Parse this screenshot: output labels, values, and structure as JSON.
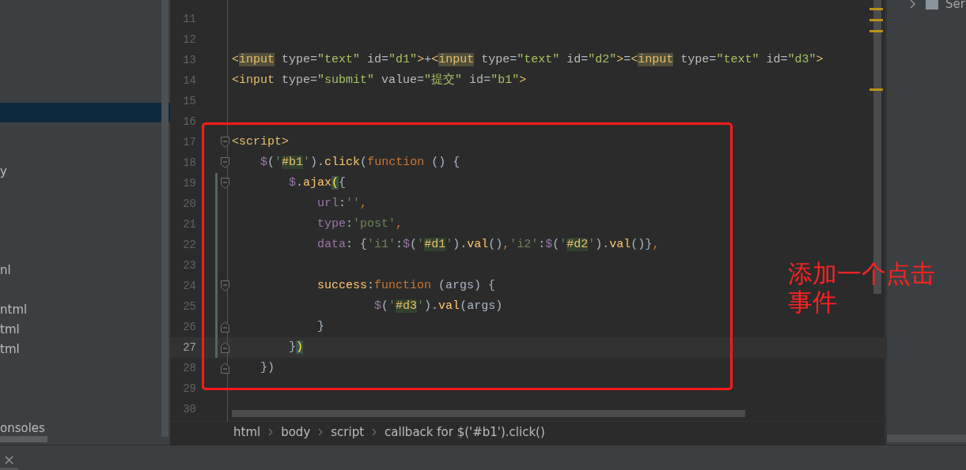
{
  "project_panel": {
    "items": [
      {
        "selected": true
      },
      {
        "label": "y",
        "selected": false
      },
      {
        "label": "nl",
        "selected": false
      },
      {
        "label": "ntml",
        "selected": false
      },
      {
        "label": "tml",
        "selected": false
      },
      {
        "label": "tml",
        "selected": false
      },
      {
        "label": "onsoles",
        "selected": false
      }
    ]
  },
  "editor": {
    "lines": [
      {
        "number": "11"
      },
      {
        "number": "12"
      },
      {
        "number": "13",
        "tokens": [
          {
            "kind": "tag",
            "text": "<"
          },
          {
            "kind": "tag_match",
            "text": "input"
          },
          {
            "kind": "attr",
            "text": " type"
          },
          {
            "kind": "punct",
            "text": "="
          },
          {
            "kind": "str",
            "text": "\"text\""
          },
          {
            "kind": "attr",
            "text": " id"
          },
          {
            "kind": "punct",
            "text": "="
          },
          {
            "kind": "str",
            "text": "\"d1\""
          },
          {
            "kind": "tag",
            "text": ">"
          },
          {
            "kind": "punct",
            "text": "+"
          },
          {
            "kind": "tag",
            "text": "<"
          },
          {
            "kind": "tag_match",
            "text": "input"
          },
          {
            "kind": "attr",
            "text": " type"
          },
          {
            "kind": "punct",
            "text": "="
          },
          {
            "kind": "str",
            "text": "\"text\""
          },
          {
            "kind": "attr",
            "text": " id"
          },
          {
            "kind": "punct",
            "text": "="
          },
          {
            "kind": "str",
            "text": "\"d2\""
          },
          {
            "kind": "tag",
            "text": ">"
          },
          {
            "kind": "punct",
            "text": "="
          },
          {
            "kind": "tag",
            "text": "<"
          },
          {
            "kind": "tag_match",
            "text": "input"
          },
          {
            "kind": "attr",
            "text": " type"
          },
          {
            "kind": "punct",
            "text": "="
          },
          {
            "kind": "str",
            "text": "\"text\""
          },
          {
            "kind": "attr",
            "text": " id"
          },
          {
            "kind": "punct",
            "text": "="
          },
          {
            "kind": "str",
            "text": "\"d3\""
          },
          {
            "kind": "tag",
            "text": ">"
          }
        ]
      },
      {
        "number": "14",
        "tokens": [
          {
            "kind": "tag",
            "text": "<input"
          },
          {
            "kind": "attr",
            "text": " type"
          },
          {
            "kind": "punct",
            "text": "="
          },
          {
            "kind": "str",
            "text": "\"submit\""
          },
          {
            "kind": "attr",
            "text": " value"
          },
          {
            "kind": "punct",
            "text": "="
          },
          {
            "kind": "str",
            "text": "\"提交\""
          },
          {
            "kind": "attr",
            "text": " id"
          },
          {
            "kind": "punct",
            "text": "="
          },
          {
            "kind": "str",
            "text": "\"b1\""
          },
          {
            "kind": "tag",
            "text": ">"
          }
        ]
      },
      {
        "number": "15"
      },
      {
        "number": "16"
      },
      {
        "number": "17",
        "fold_start": true,
        "tokens": [
          {
            "kind": "tag",
            "text": "<script>"
          }
        ]
      },
      {
        "number": "18",
        "fold_start": true,
        "tokens": [
          {
            "kind": "var",
            "text": "    $"
          },
          {
            "kind": "punct",
            "text": "("
          },
          {
            "kind": "jsstr",
            "text": "'"
          },
          {
            "kind": "sel",
            "text": "#b1"
          },
          {
            "kind": "jsstr",
            "text": "'"
          },
          {
            "kind": "punct",
            "text": ")."
          },
          {
            "kind": "fn",
            "text": "click"
          },
          {
            "kind": "punct",
            "text": "("
          },
          {
            "kind": "kw",
            "text": "function"
          },
          {
            "kind": "punct",
            "text": " () {"
          }
        ]
      },
      {
        "number": "19",
        "fold_start": true,
        "changed": true,
        "tokens": [
          {
            "kind": "var",
            "text": "        $"
          },
          {
            "kind": "punct",
            "text": "."
          },
          {
            "kind": "fn",
            "text": "ajax"
          },
          {
            "kind": "match",
            "text": "("
          },
          {
            "kind": "punct",
            "text": "{"
          }
        ]
      },
      {
        "number": "20",
        "changed": true,
        "tokens": [
          {
            "kind": "var",
            "text": "            url"
          },
          {
            "kind": "punct",
            "text": ":"
          },
          {
            "kind": "jsstr",
            "text": "''"
          },
          {
            "kind": "kw",
            "text": ","
          }
        ]
      },
      {
        "number": "21",
        "changed": true,
        "tokens": [
          {
            "kind": "var",
            "text": "            type"
          },
          {
            "kind": "punct",
            "text": ":"
          },
          {
            "kind": "jsstr",
            "text": "'post'"
          },
          {
            "kind": "kw",
            "text": ","
          }
        ]
      },
      {
        "number": "22",
        "changed": true,
        "tokens": [
          {
            "kind": "var",
            "text": "            data"
          },
          {
            "kind": "punct",
            "text": ": {"
          },
          {
            "kind": "jsstr",
            "text": "'i1'"
          },
          {
            "kind": "punct",
            "text": ":"
          },
          {
            "kind": "var",
            "text": "$"
          },
          {
            "kind": "punct",
            "text": "("
          },
          {
            "kind": "jsstr",
            "text": "'"
          },
          {
            "kind": "sel",
            "text": "#d1"
          },
          {
            "kind": "jsstr",
            "text": "'"
          },
          {
            "kind": "punct",
            "text": ")."
          },
          {
            "kind": "fn",
            "text": "val"
          },
          {
            "kind": "punct",
            "text": "()"
          },
          {
            "kind": "kw",
            "text": ","
          },
          {
            "kind": "jsstr",
            "text": "'i2'"
          },
          {
            "kind": "punct",
            "text": ":"
          },
          {
            "kind": "var",
            "text": "$"
          },
          {
            "kind": "punct",
            "text": "("
          },
          {
            "kind": "jsstr",
            "text": "'"
          },
          {
            "kind": "sel",
            "text": "#d2"
          },
          {
            "kind": "jsstr",
            "text": "'"
          },
          {
            "kind": "punct",
            "text": ")."
          },
          {
            "kind": "fn",
            "text": "val"
          },
          {
            "kind": "punct",
            "text": "()}"
          },
          {
            "kind": "kw",
            "text": ","
          }
        ]
      },
      {
        "number": "23",
        "changed": true
      },
      {
        "number": "24",
        "fold_start": true,
        "changed": true,
        "tokens": [
          {
            "kind": "fn",
            "text": "            success"
          },
          {
            "kind": "punct",
            "text": ":"
          },
          {
            "kind": "kw",
            "text": "function"
          },
          {
            "kind": "punct",
            "text": " (args) {"
          }
        ]
      },
      {
        "number": "25",
        "changed": true,
        "tokens": [
          {
            "kind": "var",
            "text": "                    $"
          },
          {
            "kind": "punct",
            "text": "("
          },
          {
            "kind": "jsstr",
            "text": "'"
          },
          {
            "kind": "sel",
            "text": "#d3"
          },
          {
            "kind": "jsstr",
            "text": "'"
          },
          {
            "kind": "punct",
            "text": ")."
          },
          {
            "kind": "fn",
            "text": "val"
          },
          {
            "kind": "punct",
            "text": "(args)"
          }
        ]
      },
      {
        "number": "26",
        "fold_end": true,
        "changed": true,
        "tokens": [
          {
            "kind": "punct",
            "text": "            }"
          }
        ]
      },
      {
        "number": "27",
        "fold_end": true,
        "changed": true,
        "current": true,
        "tokens": [
          {
            "kind": "punct",
            "text": "        }"
          },
          {
            "kind": "match",
            "text": ")"
          }
        ]
      },
      {
        "number": "28",
        "fold_end": true,
        "tokens": [
          {
            "kind": "punct",
            "text": "    })"
          }
        ]
      },
      {
        "number": "29"
      },
      {
        "number": "30"
      }
    ],
    "breadcrumbs": [
      "html",
      "body",
      "script",
      "callback for $('#b1').click()"
    ]
  },
  "right_panel": {
    "item": {
      "label": "Ser",
      "expanded": false
    }
  },
  "bottom_bar": {
    "close_glyph": "×"
  },
  "annotation": {
    "text": "添加一个点击事件"
  }
}
